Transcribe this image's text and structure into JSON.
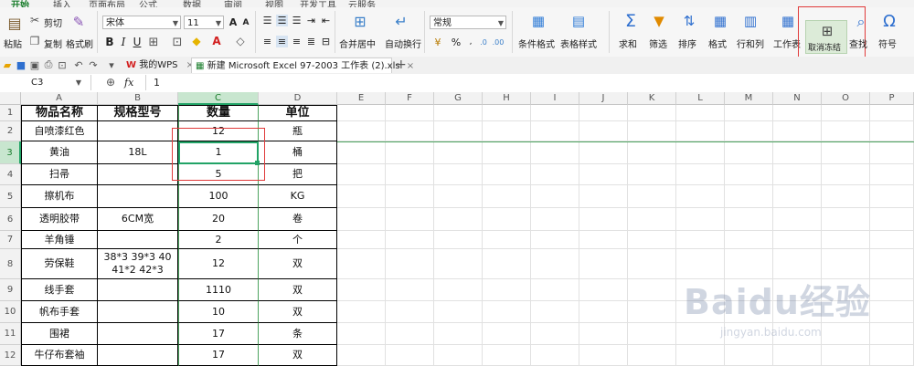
{
  "menu_tabs": [
    "开始",
    "插入",
    "页面布局",
    "公式",
    "数据",
    "审阅",
    "视图",
    "开发工具",
    "云服务"
  ],
  "ribbon": {
    "paste": "粘贴",
    "cut": "剪切",
    "copy": "复制",
    "format_painter": "格式刷",
    "font_name": "宋体",
    "font_size": "11",
    "merge_center": "合并居中",
    "wrap_text": "自动换行",
    "number_format": "常规",
    "conditional_format": "条件格式",
    "table_style": "表格样式",
    "sum": "求和",
    "filter": "筛选",
    "sort": "排序",
    "format": "格式",
    "rows_cols": "行和列",
    "worksheet": "工作表",
    "unfreeze": "取消冻结",
    "find": "查找",
    "symbol": "符号"
  },
  "doc_tabs": {
    "my_wps": "我的WPS",
    "file": "新建 Microsoft Excel 97-2003 工作表 (2).xls",
    "add": "+"
  },
  "formula_bar": {
    "cell_ref": "C3",
    "fx": "fx",
    "value": "1"
  },
  "columns": [
    "A",
    "B",
    "C",
    "D",
    "E",
    "F",
    "G",
    "H",
    "I",
    "J",
    "K",
    "L",
    "M",
    "N",
    "O",
    "P"
  ],
  "rows": [
    "1",
    "2",
    "3",
    "4",
    "5",
    "6",
    "7",
    "8",
    "9",
    "10",
    "11",
    "12"
  ],
  "sheet": [
    [
      "物品名称",
      "规格型号",
      "数量",
      "单位"
    ],
    [
      "自喷漆红色",
      "",
      "12",
      "瓶"
    ],
    [
      "黄油",
      "18L",
      "1",
      "桶"
    ],
    [
      "扫帚",
      "",
      "5",
      "把"
    ],
    [
      "擦机布",
      "",
      "100",
      "KG"
    ],
    [
      "透明胶带",
      "6CM宽",
      "20",
      "卷"
    ],
    [
      "羊角锤",
      "",
      "2",
      "个"
    ],
    [
      "劳保鞋",
      "38*3 39*3 40\n41*2 42*3",
      "12",
      "双"
    ],
    [
      "线手套",
      "",
      "1110",
      "双"
    ],
    [
      "帆布手套",
      "",
      "10",
      "双"
    ],
    [
      "围裙",
      "",
      "17",
      "条"
    ],
    [
      "牛仔布套袖",
      "",
      "17",
      "双"
    ]
  ],
  "watermark": {
    "brand": "Baidu经验",
    "url": "jingyan.baidu.com"
  },
  "colors": {
    "accent_green": "#1b7e2d",
    "selection_green": "#21a366",
    "highlight_red": "#e03a3a"
  }
}
